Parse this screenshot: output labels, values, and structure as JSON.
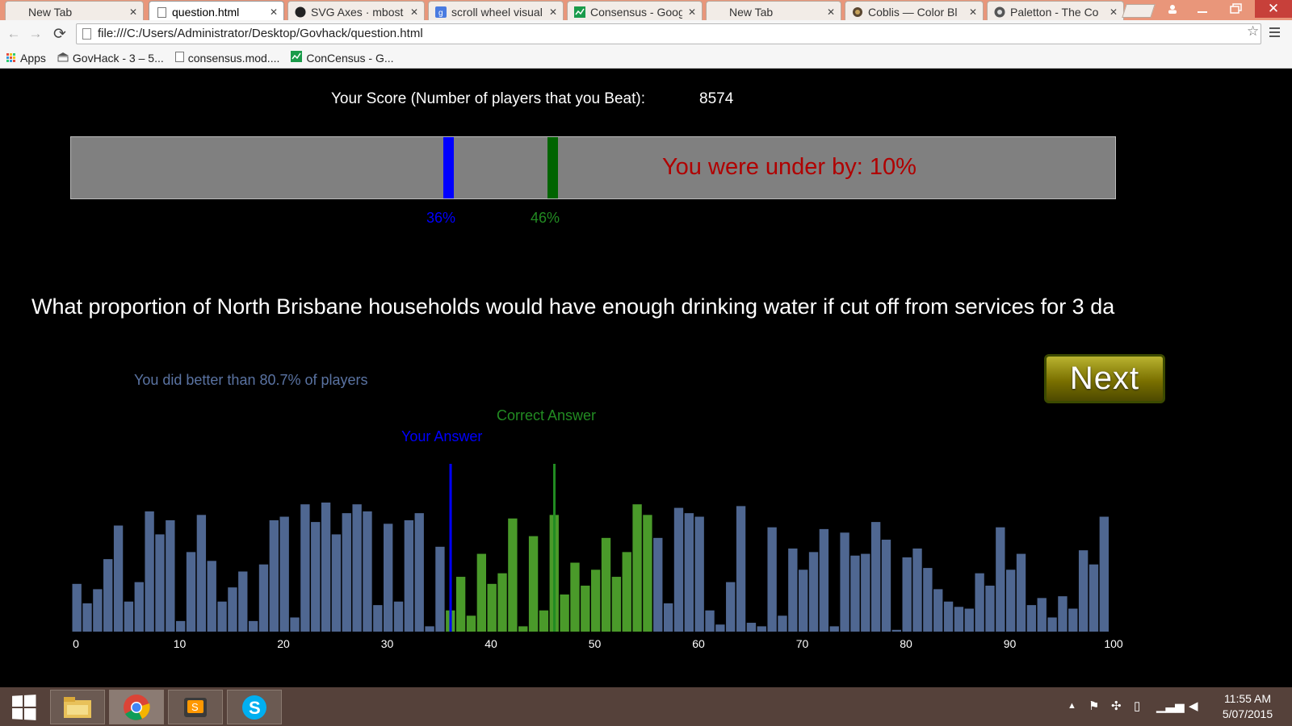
{
  "browser": {
    "tabs": [
      {
        "title": "New Tab",
        "icon": "blank",
        "active": false
      },
      {
        "title": "question.html",
        "icon": "page",
        "active": true
      },
      {
        "title": "SVG Axes · mbost",
        "icon": "github",
        "active": false
      },
      {
        "title": "scroll wheel visual",
        "icon": "google",
        "active": false
      },
      {
        "title": "Consensus - Goog",
        "icon": "sheets",
        "active": false
      },
      {
        "title": "New Tab",
        "icon": "blank",
        "active": false
      },
      {
        "title": "Coblis — Color Bl",
        "icon": "coblis",
        "active": false
      },
      {
        "title": "Paletton - The Co",
        "icon": "paletton",
        "active": false
      }
    ],
    "url": "file:///C:/Users/Administrator/Desktop/Govhack/question.html",
    "bookmarks": [
      {
        "label": "Apps",
        "icon": "apps-grid-icon"
      },
      {
        "label": "GovHack - 3 – 5...",
        "icon": "govhack-icon"
      },
      {
        "label": "consensus.mod....",
        "icon": "page-icon"
      },
      {
        "label": "ConCensus - G...",
        "icon": "sheets-icon"
      }
    ]
  },
  "page": {
    "score_label": "Your Score (Number of players that you Beat):",
    "score_value": "8574",
    "under_text": "You were under by: 10%",
    "your_pct_label": "36%",
    "correct_pct_label": "46%",
    "question": "What proportion of North Brisbane households would have enough drinking water if cut off from services for 3 da",
    "better_than": "You did better than 80.7% of players",
    "next_label": "Next",
    "correct_legend": "Correct Answer",
    "your_legend": "Your Answer",
    "colors": {
      "blue_marker": "#0000ff",
      "green_marker": "#006400",
      "bar_default": "#4f6791",
      "bar_range": "#4a9a2a",
      "under_text": "#b00000"
    }
  },
  "chart_data": {
    "type": "bar",
    "xlabel": "",
    "ylabel": "",
    "xlim": [
      0,
      100
    ],
    "x_ticks": [
      0,
      10,
      20,
      30,
      40,
      50,
      60,
      70,
      80,
      90,
      100
    ],
    "your_answer": 36,
    "correct_answer": 46,
    "highlight_range": [
      36,
      56
    ],
    "bins": [
      0,
      1,
      2,
      3,
      4,
      5,
      6,
      7,
      8,
      9,
      10,
      11,
      12,
      13,
      14,
      15,
      16,
      17,
      18,
      19,
      20,
      21,
      22,
      23,
      24,
      25,
      26,
      27,
      28,
      29,
      30,
      31,
      32,
      33,
      34,
      35,
      36,
      37,
      38,
      39,
      40,
      41,
      42,
      43,
      44,
      45,
      46,
      47,
      48,
      49,
      50,
      51,
      52,
      53,
      54,
      55,
      56,
      57,
      58,
      59,
      60,
      61,
      62,
      63,
      64,
      65,
      66,
      67,
      68,
      69,
      70,
      71,
      72,
      73,
      74,
      75,
      76,
      77,
      78,
      79,
      80,
      81,
      82,
      83,
      84,
      85,
      86,
      87,
      88,
      89,
      90,
      91,
      92,
      93,
      94,
      95,
      96,
      97,
      98,
      99
    ],
    "values": [
      27,
      16,
      24,
      41,
      60,
      17,
      28,
      68,
      55,
      63,
      6,
      45,
      66,
      40,
      17,
      25,
      34,
      6,
      38,
      63,
      65,
      8,
      72,
      62,
      73,
      55,
      67,
      72,
      68,
      15,
      61,
      17,
      63,
      67,
      3,
      48,
      12,
      31,
      9,
      44,
      27,
      33,
      64,
      3,
      54,
      12,
      66,
      21,
      39,
      26,
      35,
      53,
      31,
      45,
      72,
      66,
      53,
      16,
      70,
      67,
      65,
      12,
      4,
      28,
      71,
      5,
      3,
      59,
      9,
      47,
      35,
      45,
      58,
      3,
      56,
      43,
      44,
      62,
      52,
      1,
      42,
      47,
      36,
      24,
      17,
      14,
      13,
      33,
      26,
      59,
      35,
      44,
      15,
      19,
      8,
      20,
      13,
      46,
      38,
      65
    ],
    "y_max": 73
  },
  "taskbar": {
    "time": "11:55 AM",
    "date": "5/07/2015",
    "apps": [
      "file-explorer-icon",
      "chrome-icon",
      "sublime-text-icon",
      "skype-icon"
    ]
  }
}
